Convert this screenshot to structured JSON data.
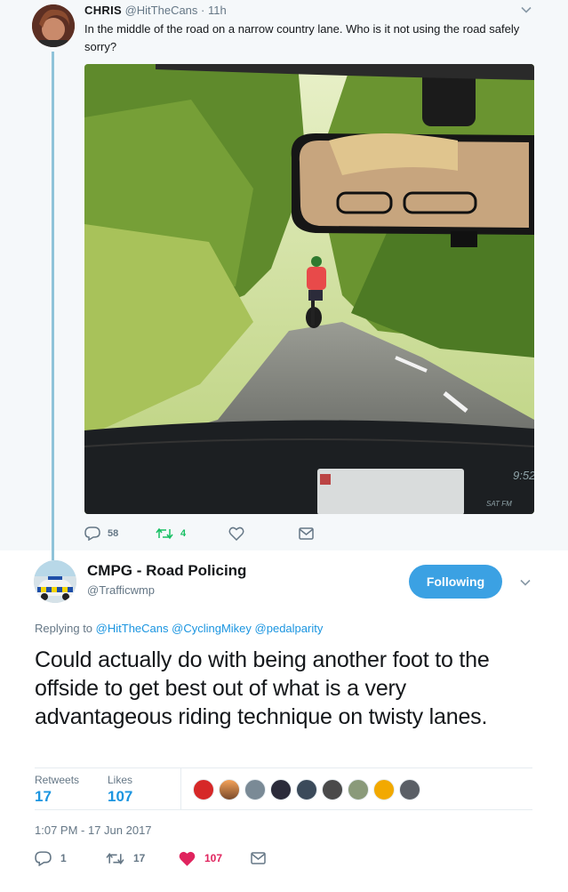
{
  "parent_tweet": {
    "author_name": "CHRIS",
    "handle": "@HitTheCans",
    "separator": "·",
    "time": "11h",
    "text": "In the middle of the road on a narrow country lane. Who is it not using the road safely sorry?",
    "dashboard_clock": "9:52",
    "dashboard_date": "SAT FM",
    "actions": {
      "reply_count": "58",
      "retweet_count": "4"
    }
  },
  "main_tweet": {
    "author_name": "CMPG - Road Policing",
    "handle": "@Trafficwmp",
    "follow_label": "Following",
    "replying_prefix": "Replying to",
    "replying_to": [
      "@HitTheCans",
      "@CyclingMikey",
      "@pedalparity"
    ],
    "text": "Could actually do with being another foot to the offside to get best out of what is a very advantageous riding technique on twisty lanes.",
    "stats": {
      "retweets_label": "Retweets",
      "retweets_value": "17",
      "likes_label": "Likes",
      "likes_value": "107"
    },
    "timestamp": "1:07 PM - 17 Jun 2017",
    "actions": {
      "reply_count": "1",
      "retweet_count": "17",
      "like_count": "107"
    }
  },
  "colors": {
    "link": "#1b95e0",
    "follow_button": "#3ba1e3",
    "like": "#e0245e",
    "retweet": "#17bf63",
    "muted": "#657786",
    "thread_line": "#8fc3d9"
  },
  "icons": [
    "chevron-down-icon",
    "reply-icon",
    "retweet-icon",
    "like-icon",
    "message-icon"
  ]
}
